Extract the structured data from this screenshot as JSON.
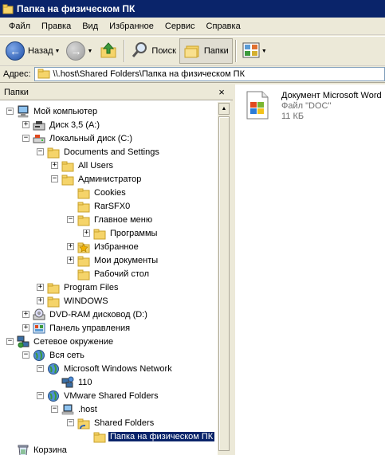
{
  "window": {
    "title": "Папка на физическом ПК"
  },
  "menu": [
    "Файл",
    "Правка",
    "Вид",
    "Избранное",
    "Сервис",
    "Справка"
  ],
  "toolbar": {
    "back": "Назад",
    "search": "Поиск",
    "folders": "Папки"
  },
  "address": {
    "label": "Адрес:",
    "value": "\\\\.host\\Shared Folders\\Папка на физическом ПК"
  },
  "pane": {
    "title": "Папки",
    "close": "×"
  },
  "tree": [
    {
      "label": "Мой компьютер",
      "exp": "−",
      "icon": "computer-icon"
    },
    {
      "label": "Диск 3,5 (A:)",
      "exp": "+",
      "icon": "floppy-icon"
    },
    {
      "label": "Локальный диск (C:)",
      "exp": "−",
      "icon": "disk-icon"
    },
    {
      "label": "Documents and Settings",
      "exp": "−",
      "icon": "folder-icon"
    },
    {
      "label": "All Users",
      "exp": "+",
      "icon": "folder-icon"
    },
    {
      "label": "Администратор",
      "exp": "−",
      "icon": "folder-icon"
    },
    {
      "label": "Cookies",
      "exp": "",
      "icon": "folder-icon"
    },
    {
      "label": "RarSFX0",
      "exp": "",
      "icon": "folder-icon"
    },
    {
      "label": "Главное меню",
      "exp": "−",
      "icon": "folder-icon"
    },
    {
      "label": "Программы",
      "exp": "+",
      "icon": "folder-icon"
    },
    {
      "label": "Избранное",
      "exp": "+",
      "icon": "favorites-folder-icon"
    },
    {
      "label": "Мои документы",
      "exp": "+",
      "icon": "folder-icon"
    },
    {
      "label": "Рабочий стол",
      "exp": "",
      "icon": "folder-icon"
    },
    {
      "label": "Program Files",
      "exp": "+",
      "icon": "folder-icon"
    },
    {
      "label": "WINDOWS",
      "exp": "+",
      "icon": "folder-icon"
    },
    {
      "label": "DVD-RAM дисковод (D:)",
      "exp": "+",
      "icon": "dvd-icon"
    },
    {
      "label": "Панель управления",
      "exp": "+",
      "icon": "control-panel-icon"
    },
    {
      "label": "Сетевое окружение",
      "exp": "−",
      "icon": "network-icon"
    },
    {
      "label": "Вся сеть",
      "exp": "−",
      "icon": "globe-network-icon"
    },
    {
      "label": "Microsoft Windows Network",
      "exp": "−",
      "icon": "globe-network-icon"
    },
    {
      "label": "110",
      "exp": "",
      "icon": "workgroup-icon"
    },
    {
      "label": "VMware Shared Folders",
      "exp": "−",
      "icon": "globe-network-icon"
    },
    {
      "label": ".host",
      "exp": "−",
      "icon": "server-icon"
    },
    {
      "label": "Shared Folders",
      "exp": "−",
      "icon": "shared-folder-icon"
    },
    {
      "label": "Папка на физическом ПК",
      "exp": "",
      "icon": "folder-icon",
      "selected": true
    },
    {
      "label": "Корзина",
      "exp": "",
      "icon": "recycle-bin-icon"
    }
  ],
  "file": {
    "name": "Документ Microsoft Word",
    "type": "Файл \"DOC\"",
    "size": "11 КБ",
    "icon": "word-document-icon"
  }
}
